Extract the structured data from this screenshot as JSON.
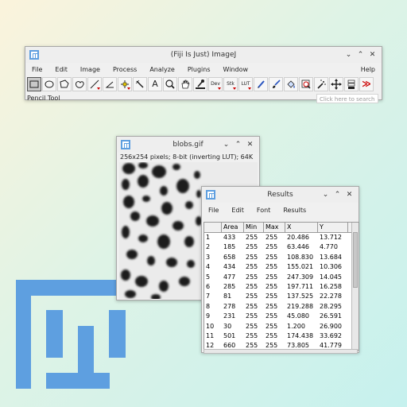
{
  "main_window": {
    "title": "(Fiji Is Just) ImageJ",
    "menus": [
      "File",
      "Edit",
      "Image",
      "Process",
      "Analyze",
      "Plugins",
      "Window"
    ],
    "help_menu": "Help",
    "status": "Pencil Tool",
    "search_placeholder": "Click here to search",
    "tools": [
      {
        "name": "rectangle-tool-icon",
        "label": ""
      },
      {
        "name": "oval-tool-icon",
        "label": ""
      },
      {
        "name": "polygon-tool-icon",
        "label": ""
      },
      {
        "name": "freehand-tool-icon",
        "label": ""
      },
      {
        "name": "line-tool-icon",
        "label": ""
      },
      {
        "name": "angle-tool-icon",
        "label": ""
      },
      {
        "name": "point-tool-icon",
        "label": ""
      },
      {
        "name": "wand-tool-icon",
        "label": ""
      },
      {
        "name": "text-tool-icon",
        "label": "A"
      },
      {
        "name": "magnifier-tool-icon",
        "label": ""
      },
      {
        "name": "hand-tool-icon",
        "label": ""
      },
      {
        "name": "color-picker-tool-icon",
        "label": ""
      },
      {
        "name": "developer-menu-icon",
        "label": "Dev"
      },
      {
        "name": "stack-tools-icon",
        "label": "Stk"
      },
      {
        "name": "lut-menu-icon",
        "label": "LUT"
      },
      {
        "name": "pencil-tool-icon",
        "label": ""
      },
      {
        "name": "brush-tool-icon",
        "label": ""
      },
      {
        "name": "flood-fill-tool-icon",
        "label": ""
      },
      {
        "name": "zoom-tool-icon",
        "label": ""
      },
      {
        "name": "magic-wand-tool-icon",
        "label": ""
      },
      {
        "name": "move-tool-icon",
        "label": ""
      },
      {
        "name": "stack-tool-icon",
        "label": ""
      },
      {
        "name": "more-tools-icon",
        "label": "≫"
      }
    ]
  },
  "blobs_window": {
    "title": "blobs.gif",
    "info": "256x254 pixels; 8-bit (inverting LUT); 64K"
  },
  "results_window": {
    "title": "Results",
    "menus": [
      "File",
      "Edit",
      "Font",
      "Results"
    ],
    "columns": [
      "",
      "Area",
      "Min",
      "Max",
      "X",
      "Y"
    ],
    "rows": [
      [
        "1",
        "433",
        "255",
        "255",
        "20.486",
        "13.712"
      ],
      [
        "2",
        "185",
        "255",
        "255",
        "63.446",
        "4.770"
      ],
      [
        "3",
        "658",
        "255",
        "255",
        "108.830",
        "13.684"
      ],
      [
        "4",
        "434",
        "255",
        "255",
        "155.021",
        "10.306"
      ],
      [
        "5",
        "477",
        "255",
        "255",
        "247.309",
        "14.045"
      ],
      [
        "6",
        "285",
        "255",
        "255",
        "197.711",
        "16.258"
      ],
      [
        "7",
        "81",
        "255",
        "255",
        "137.525",
        "22.278"
      ],
      [
        "8",
        "278",
        "255",
        "255",
        "219.288",
        "28.295"
      ],
      [
        "9",
        "231",
        "255",
        "255",
        "45.080",
        "26.591"
      ],
      [
        "10",
        "30",
        "255",
        "255",
        "1.200",
        "26.900"
      ],
      [
        "11",
        "501",
        "255",
        "255",
        "174.438",
        "33.692"
      ],
      [
        "12",
        "660",
        "255",
        "255",
        "73.805",
        "41.779"
      ]
    ]
  },
  "window_buttons": {
    "minimize": "⌄",
    "maximize": "⌃",
    "close": "✕"
  },
  "colors": {
    "fiji_blue": "#5e9fe0",
    "dropdown_red": "#cc0000"
  }
}
